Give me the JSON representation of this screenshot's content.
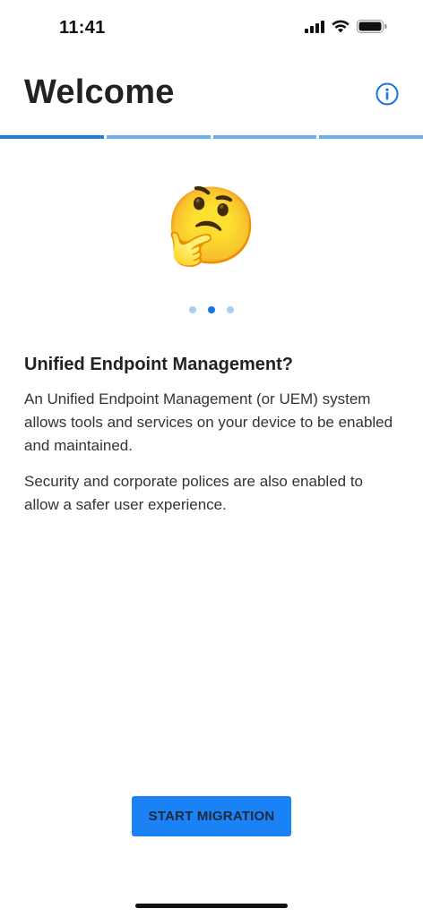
{
  "status_bar": {
    "time": "11:41",
    "icons": [
      "cellular-signal-icon",
      "wifi-icon",
      "battery-icon"
    ]
  },
  "header": {
    "title": "Welcome",
    "info_icon": "info-icon"
  },
  "progress": {
    "total_steps": 4,
    "current_step": 1
  },
  "slide": {
    "emoji": "🤔",
    "total_pages": 3,
    "current_page": 2,
    "heading": "Unified Endpoint Management?",
    "paragraphs": [
      "An Unified Endpoint Management (or UEM) system allows tools and services on your device to be enabled and maintained.",
      "Security and corporate polices are also enabled to allow a safer user experience."
    ]
  },
  "actions": {
    "start_label": "START MIGRATION"
  },
  "colors": {
    "accent": "#1a82f5",
    "progress_active": "#1e7fe0",
    "progress_inactive": "#6aaeea",
    "dot_active": "#1a73e0",
    "dot_inactive": "#a9cff3"
  }
}
